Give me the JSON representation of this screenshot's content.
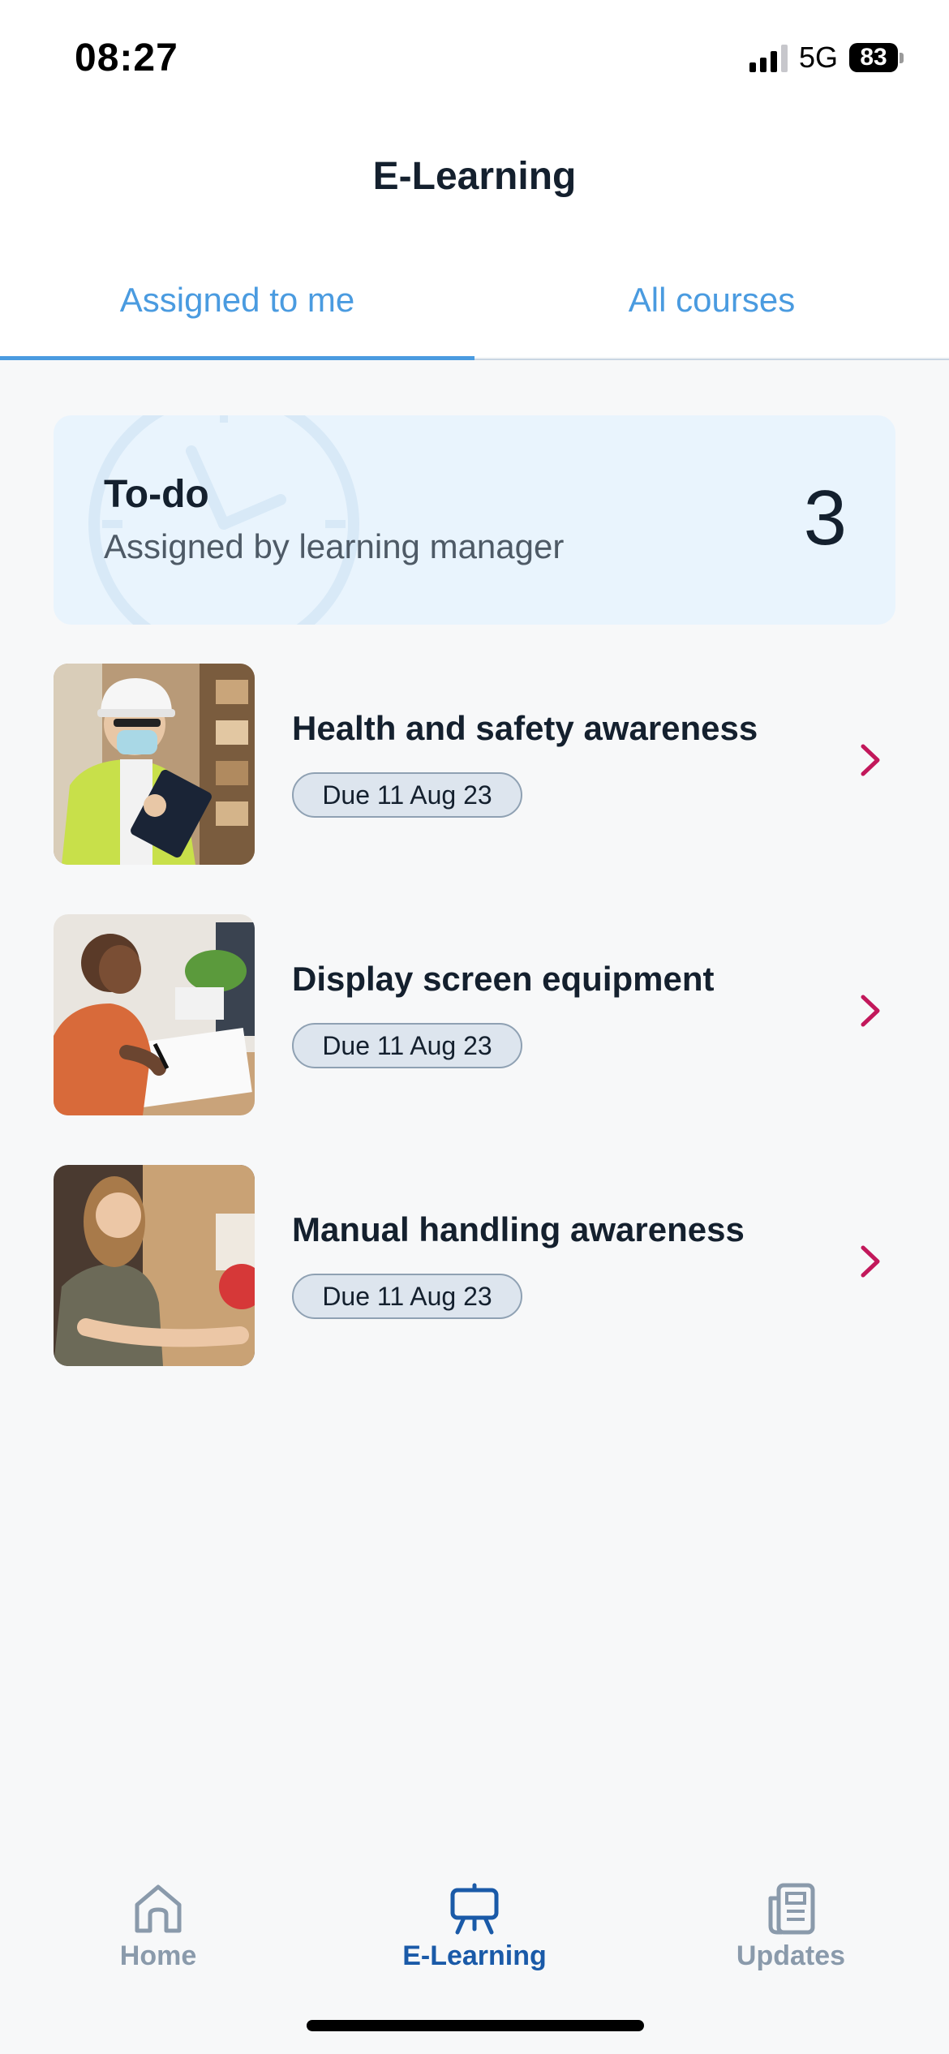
{
  "status_bar": {
    "time": "08:27",
    "network": "5G",
    "battery": "83",
    "signal_bars_filled": 3
  },
  "header": {
    "title": "E-Learning"
  },
  "tabs": [
    {
      "label": "Assigned to me",
      "active": true
    },
    {
      "label": "All courses",
      "active": false
    }
  ],
  "todo": {
    "title": "To-do",
    "subtitle": "Assigned by learning manager",
    "count": "3"
  },
  "courses": [
    {
      "title": "Health and safety awareness",
      "due": "Due 11 Aug 23",
      "image": "warehouse-worker-photo"
    },
    {
      "title": "Display screen equipment",
      "due": "Due 11 Aug 23",
      "image": "woman-writing-at-desk-photo"
    },
    {
      "title": "Manual handling awareness",
      "due": "Due 11 Aug 23",
      "image": "woman-carrying-box-photo"
    }
  ],
  "bottom_nav": [
    {
      "label": "Home",
      "icon": "home-icon",
      "active": false
    },
    {
      "label": "E-Learning",
      "icon": "presentation-board-icon",
      "active": true
    },
    {
      "label": "Updates",
      "icon": "newspaper-icon",
      "active": false
    }
  ],
  "colors": {
    "accent_blue": "#4a9be0",
    "nav_active": "#1a5aa8",
    "chevron": "#c2185b",
    "todo_card_bg": "#e9f4fd"
  }
}
